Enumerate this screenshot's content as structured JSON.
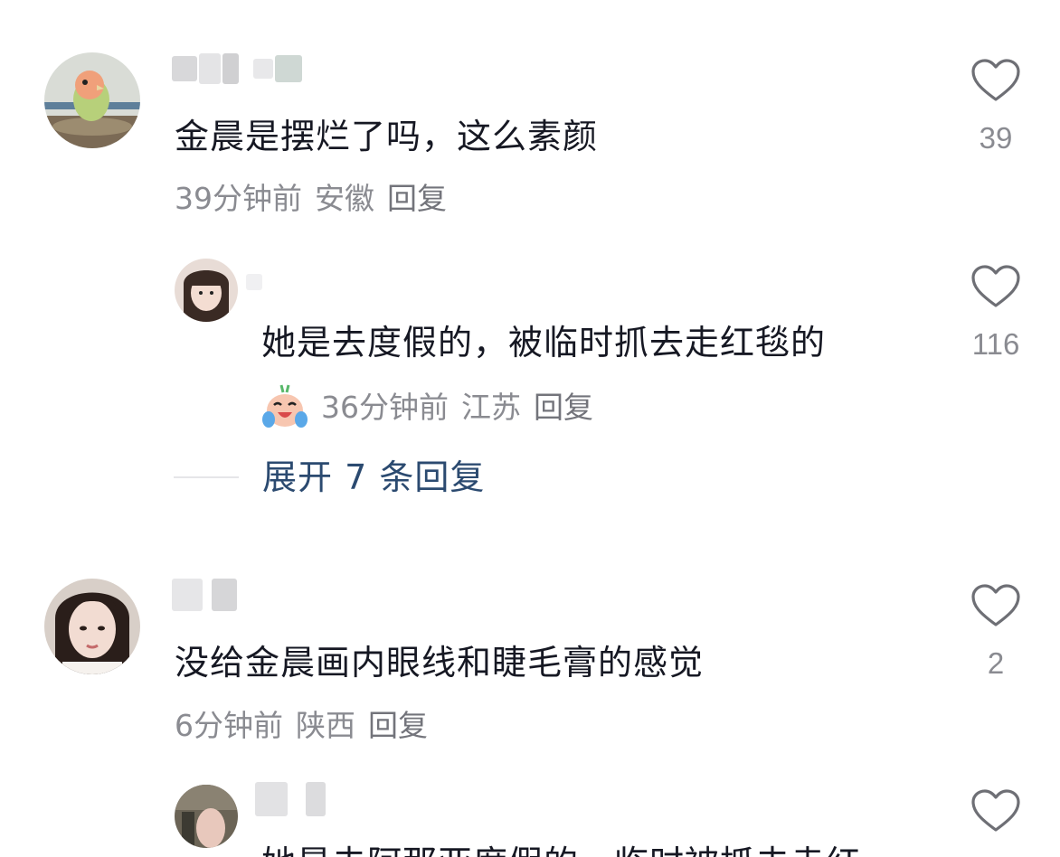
{
  "comments": [
    {
      "text": "金晨是摆烂了吗，这么素颜",
      "time": "39分钟前",
      "location": "安徽",
      "reply_label": "回复",
      "likes": "39"
    },
    {
      "text": "她是去度假的，被临时抓去走红毯的",
      "time": "36分钟前",
      "location": "江苏",
      "reply_label": "回复",
      "likes": "116",
      "sticker_icon": "laughing-crying-face-icon"
    },
    {
      "text": "没给金晨画内眼线和睫毛膏的感觉",
      "time": "6分钟前",
      "location": "陕西",
      "reply_label": "回复",
      "likes": "2"
    },
    {
      "text": "她是去阿那亚度假的，临时被抓去走红",
      "likes": ""
    }
  ],
  "expand_replies": "展开 7 条回复",
  "colors": {
    "text": "#161823",
    "meta": "#8a8b91",
    "link": "#2b4a70",
    "heart_outline": "#6e6f75"
  }
}
